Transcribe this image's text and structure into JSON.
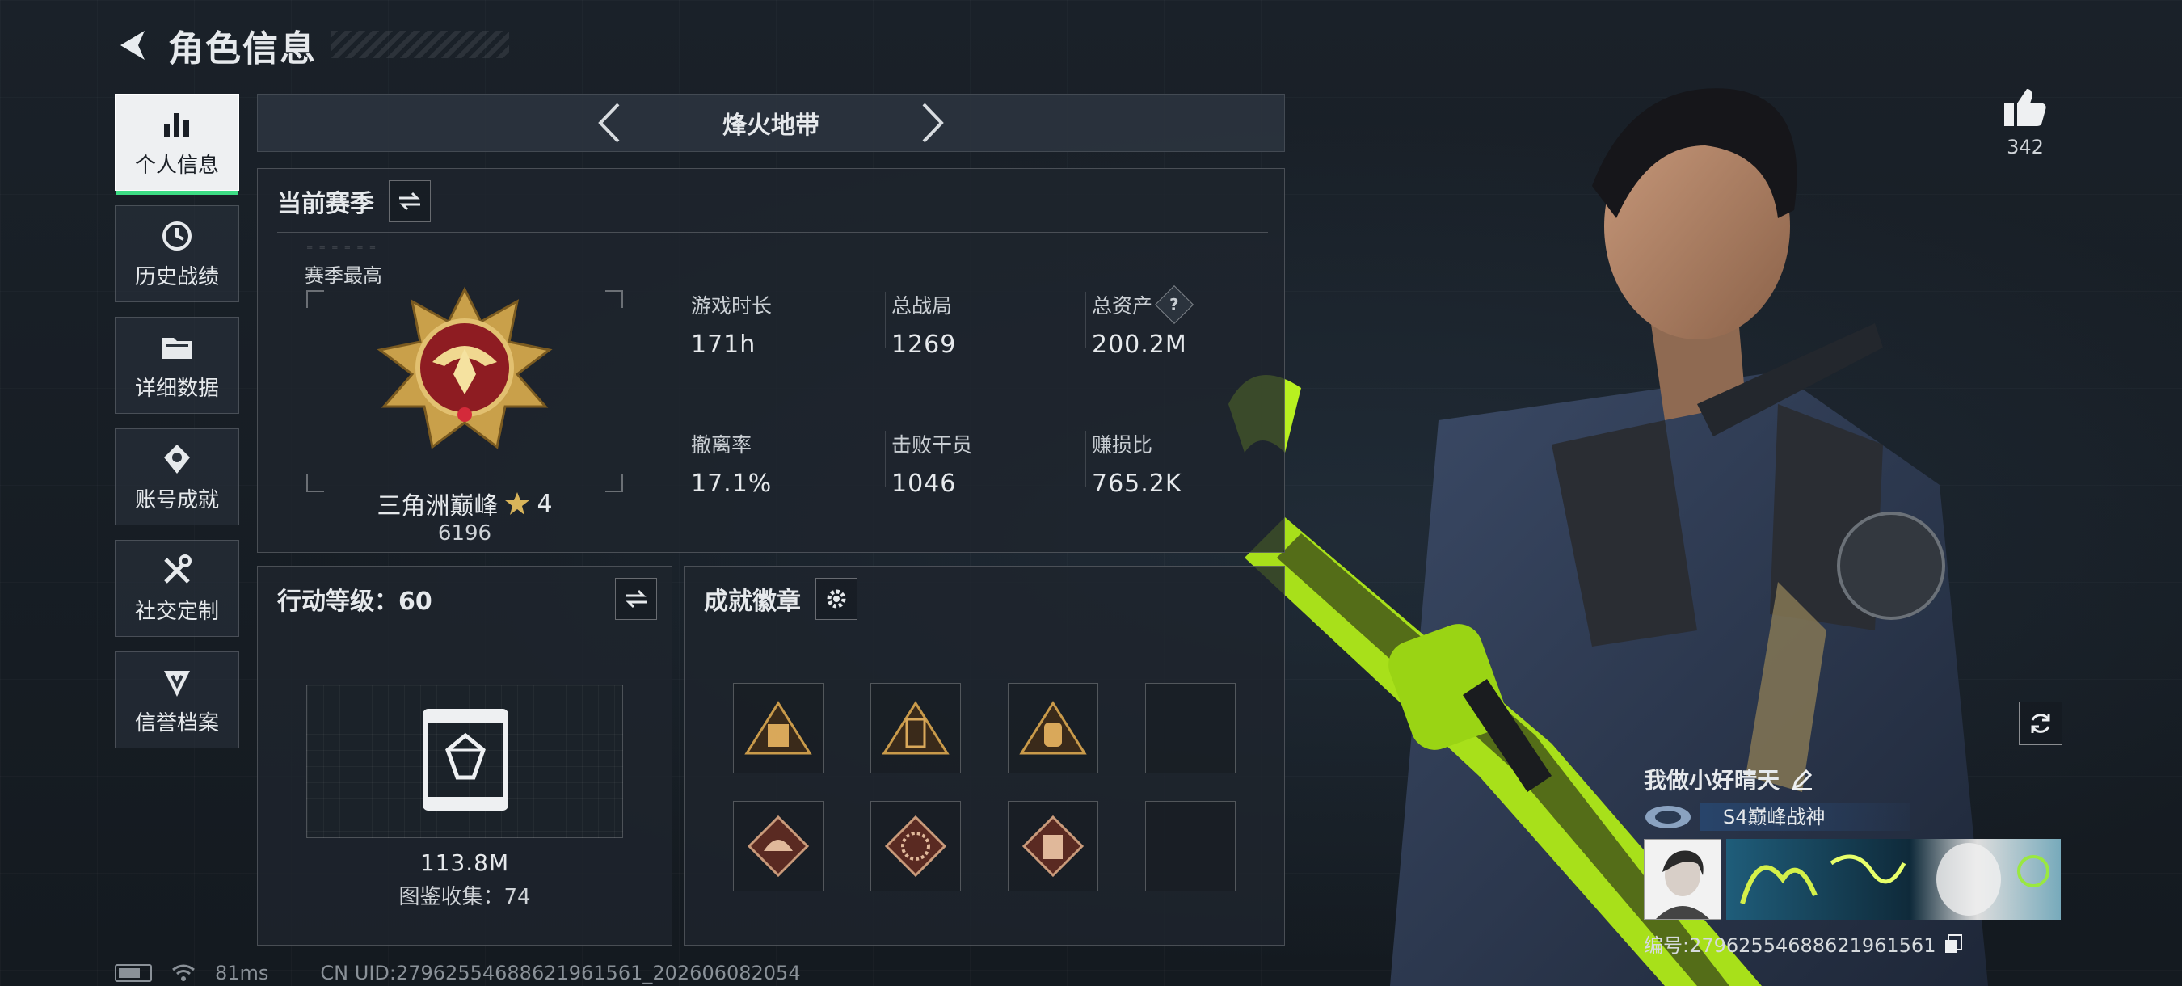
{
  "header": {
    "title": "角色信息"
  },
  "sidebar": {
    "items": [
      {
        "label": "个人信息",
        "icon": "bar-chart-icon",
        "active": true
      },
      {
        "label": "历史战绩",
        "icon": "history-clock-icon",
        "active": false
      },
      {
        "label": "详细数据",
        "icon": "folder-icon",
        "active": false
      },
      {
        "label": "账号成就",
        "icon": "achievement-icon",
        "active": false
      },
      {
        "label": "社交定制",
        "icon": "tools-icon",
        "active": false
      },
      {
        "label": "信誉档案",
        "icon": "reputation-icon",
        "active": false
      }
    ]
  },
  "mode": {
    "name": "烽火地带"
  },
  "season": {
    "title": "当前赛季",
    "best_label": "赛季最高",
    "rank_name": "三角洲巅峰",
    "rank_stars": "4",
    "rank_score": "6196",
    "stats": [
      {
        "label": "游戏时长",
        "value": "171h"
      },
      {
        "label": "总战局",
        "value": "1269"
      },
      {
        "label": "总资产",
        "value": "200.2M",
        "help": "?"
      },
      {
        "label": "撤离率",
        "value": "17.1%"
      },
      {
        "label": "击败干员",
        "value": "1046"
      },
      {
        "label": "赚损比",
        "value": "765.2K"
      }
    ]
  },
  "level": {
    "title": "行动等级：60",
    "value": "113.8M",
    "collection": "图鉴收集：74"
  },
  "badges": {
    "title": "成就徽章"
  },
  "likes": {
    "count": "342"
  },
  "player": {
    "name": "我做小好晴天",
    "title": "S4巅峰战神",
    "id_text": "编号:27962554688621961561"
  },
  "footer": {
    "ping": "81ms",
    "uid": "CN UID:27962554688621961561_202606082054"
  },
  "colors": {
    "accent_green": "#3ddc84",
    "gold": "#c9a04a"
  }
}
